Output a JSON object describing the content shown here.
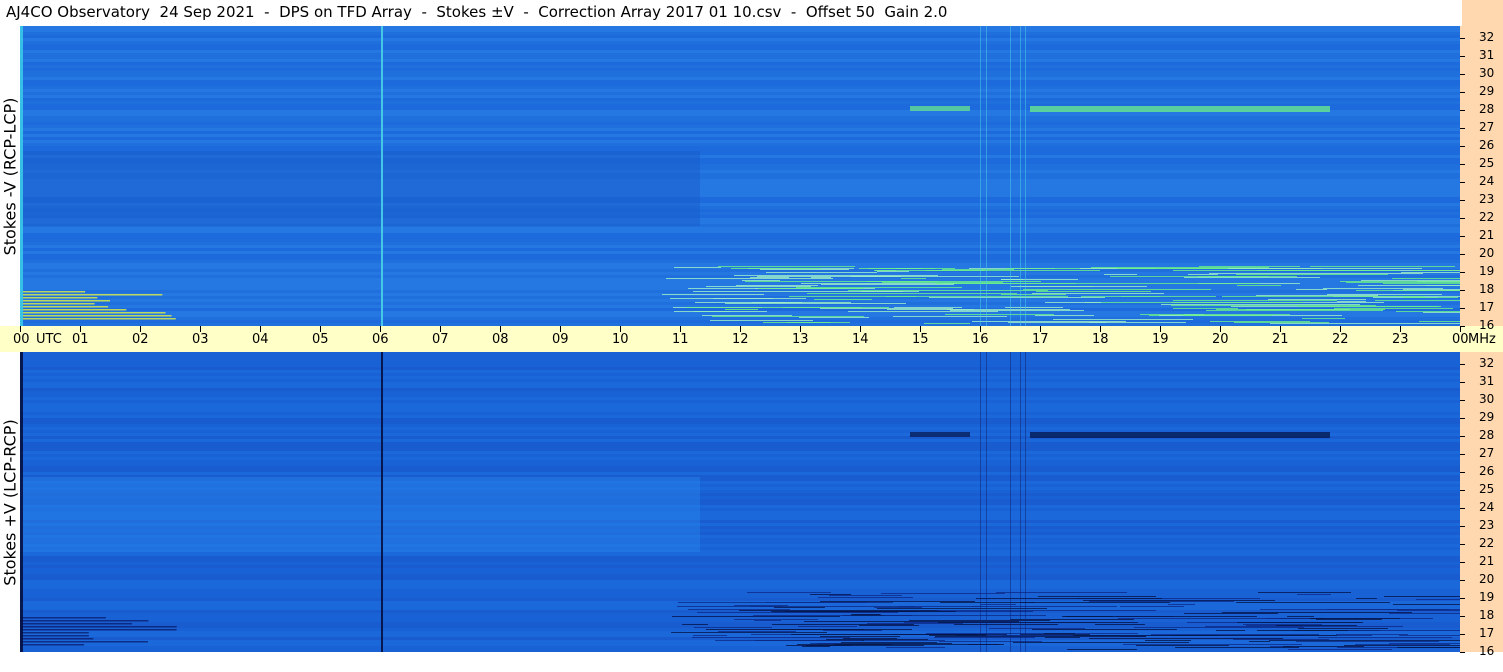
{
  "title": "AJ4CO Observatory  24 Sep 2021  -  DPS on TFD Array  -  Stokes ±V  -  Correction Array 2017 01 10.csv  -  Offset 50  Gain 2.0",
  "panels": {
    "top_label": "Stokes -V (RCP-LCP)",
    "bottom_label": "Stokes +V (LCP-RCP)"
  },
  "time_axis": {
    "labels": [
      "00",
      "UTC",
      "01",
      "02",
      "03",
      "04",
      "05",
      "06",
      "07",
      "08",
      "09",
      "10",
      "11",
      "12",
      "13",
      "14",
      "15",
      "16",
      "17",
      "18",
      "19",
      "20",
      "21",
      "22",
      "23",
      "00",
      "MHz"
    ]
  },
  "freq_axis": {
    "labels": [
      "32",
      "31",
      "30",
      "29",
      "28",
      "27",
      "26",
      "25",
      "24",
      "23",
      "22",
      "21",
      "20",
      "19",
      "18",
      "17",
      "16"
    ]
  },
  "colors": {
    "background_top": "#1f6fdd",
    "background_bottom": "#1a63d6",
    "axis_band": "#ffffc8",
    "freq_band": "#ffd8b0",
    "bright": "#6cf08a",
    "dark": "#05154a"
  }
}
